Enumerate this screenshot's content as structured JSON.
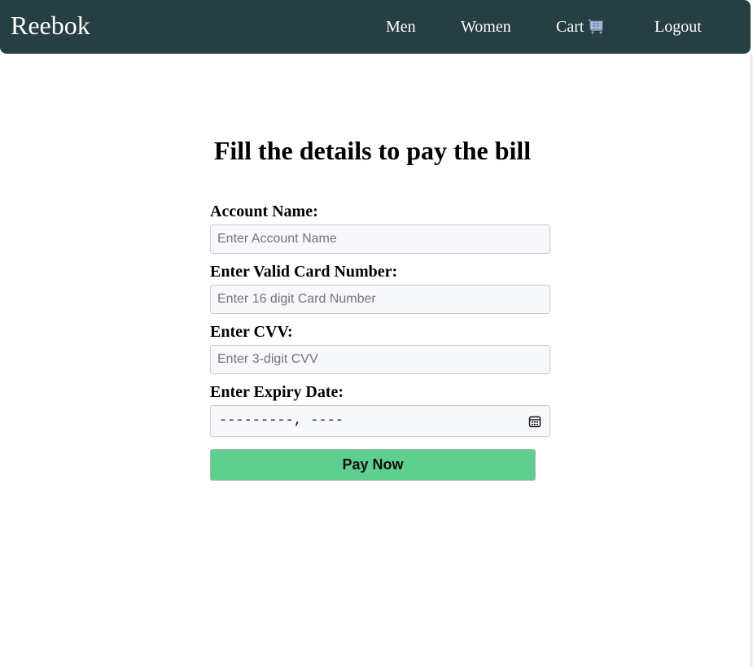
{
  "nav": {
    "brand": "Reebok",
    "links": [
      {
        "label": "Men"
      },
      {
        "label": "Women"
      },
      {
        "label": "Cart",
        "icon": "cart-icon"
      },
      {
        "label": "Logout"
      }
    ]
  },
  "main": {
    "title": "Fill the details to pay the bill"
  },
  "form": {
    "account_name": {
      "label": "Account Name:",
      "placeholder": "Enter Account Name",
      "value": ""
    },
    "card_number": {
      "label": "Enter Valid Card Number:",
      "placeholder": "Enter 16 digit Card Number",
      "value": ""
    },
    "cvv": {
      "label": "Enter CVV:",
      "placeholder": "Enter 3-digit CVV",
      "value": ""
    },
    "expiry": {
      "label": "Enter Expiry Date:",
      "value": "---------, ----",
      "icon": "calendar-icon"
    },
    "submit_label": "Pay Now"
  },
  "colors": {
    "navbar": "#263f42",
    "button": "#5ecf8f",
    "input_bg": "#f7f8fc"
  }
}
